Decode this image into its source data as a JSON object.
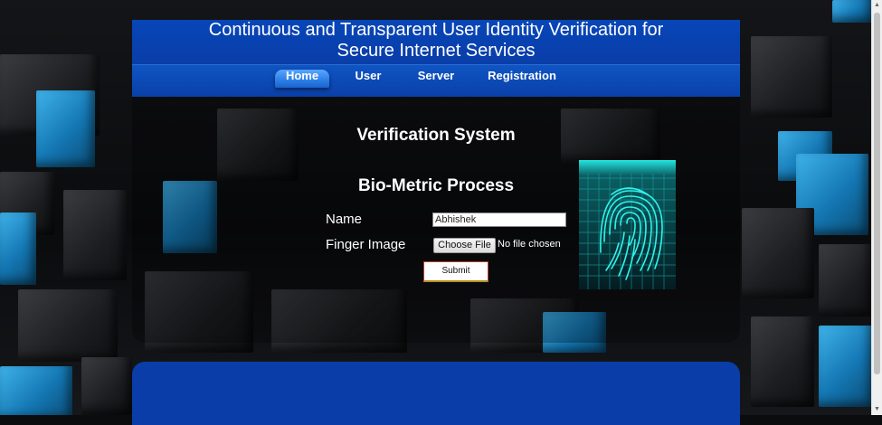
{
  "header": {
    "title_line1": "Continuous and Transparent User Identity Verification for",
    "title_line2": "Secure Internet Services"
  },
  "nav": {
    "items": [
      {
        "label": "Home",
        "active": true
      },
      {
        "label": "User",
        "active": false
      },
      {
        "label": "Server",
        "active": false
      },
      {
        "label": "Registration",
        "active": false
      }
    ]
  },
  "main": {
    "heading": "Verification System",
    "subheading": "Bio-Metric Process",
    "form": {
      "name_label": "Name",
      "name_value": "Abhishek",
      "finger_label": "Finger Image",
      "choose_file_label": "Choose File",
      "file_status": "No file chosen",
      "submit_label": "Submit"
    }
  },
  "colors": {
    "header_blue": "#0a3da8",
    "active_tab": "#2c7ee6",
    "fingerprint": "#22e0d8"
  },
  "icons": [
    "fingerprint-image"
  ]
}
